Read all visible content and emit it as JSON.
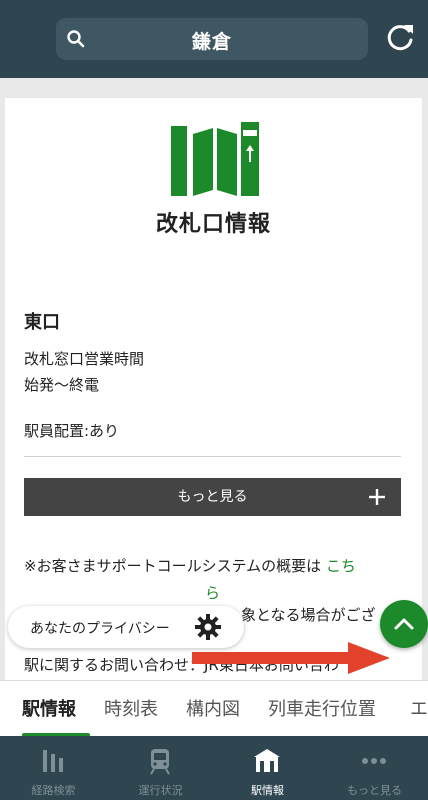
{
  "header": {
    "search_title": "鎌倉"
  },
  "card": {
    "section_title": "改札口情報",
    "exit_name": "東口",
    "hours_label": "改札窓口営業時間",
    "hours_value": "始発〜終電",
    "staff": "駅員配置:あり",
    "more_label": "もっと見る",
    "support_text": "※お客さまサポートコールシステムの概要は",
    "support_link_1": "こち",
    "support_link_2": "ら",
    "partial_line_a": "象となる場合がござ",
    "partial_line_b": "駅に関するお問い合わせ：JR東日本お問い合わ"
  },
  "privacy": {
    "label": "あなたのプライバシー"
  },
  "tabs": [
    {
      "label": "駅情報",
      "active": true
    },
    {
      "label": "時刻表",
      "active": false
    },
    {
      "label": "構内図",
      "active": false
    },
    {
      "label": "列車走行位置",
      "active": false
    },
    {
      "label": "エ",
      "active": false
    }
  ],
  "bottom_nav": [
    {
      "label": "経路検索",
      "icon": "route-icon",
      "active": false
    },
    {
      "label": "運行状況",
      "icon": "train-icon",
      "active": false
    },
    {
      "label": "駅情報",
      "icon": "station-icon",
      "active": true
    },
    {
      "label": "もっと見る",
      "icon": "more-dots-icon",
      "active": false
    }
  ],
  "colors": {
    "header_bg": "#2f4651",
    "accent_green": "#1c8a2a",
    "arrow_red": "#e2422b"
  }
}
